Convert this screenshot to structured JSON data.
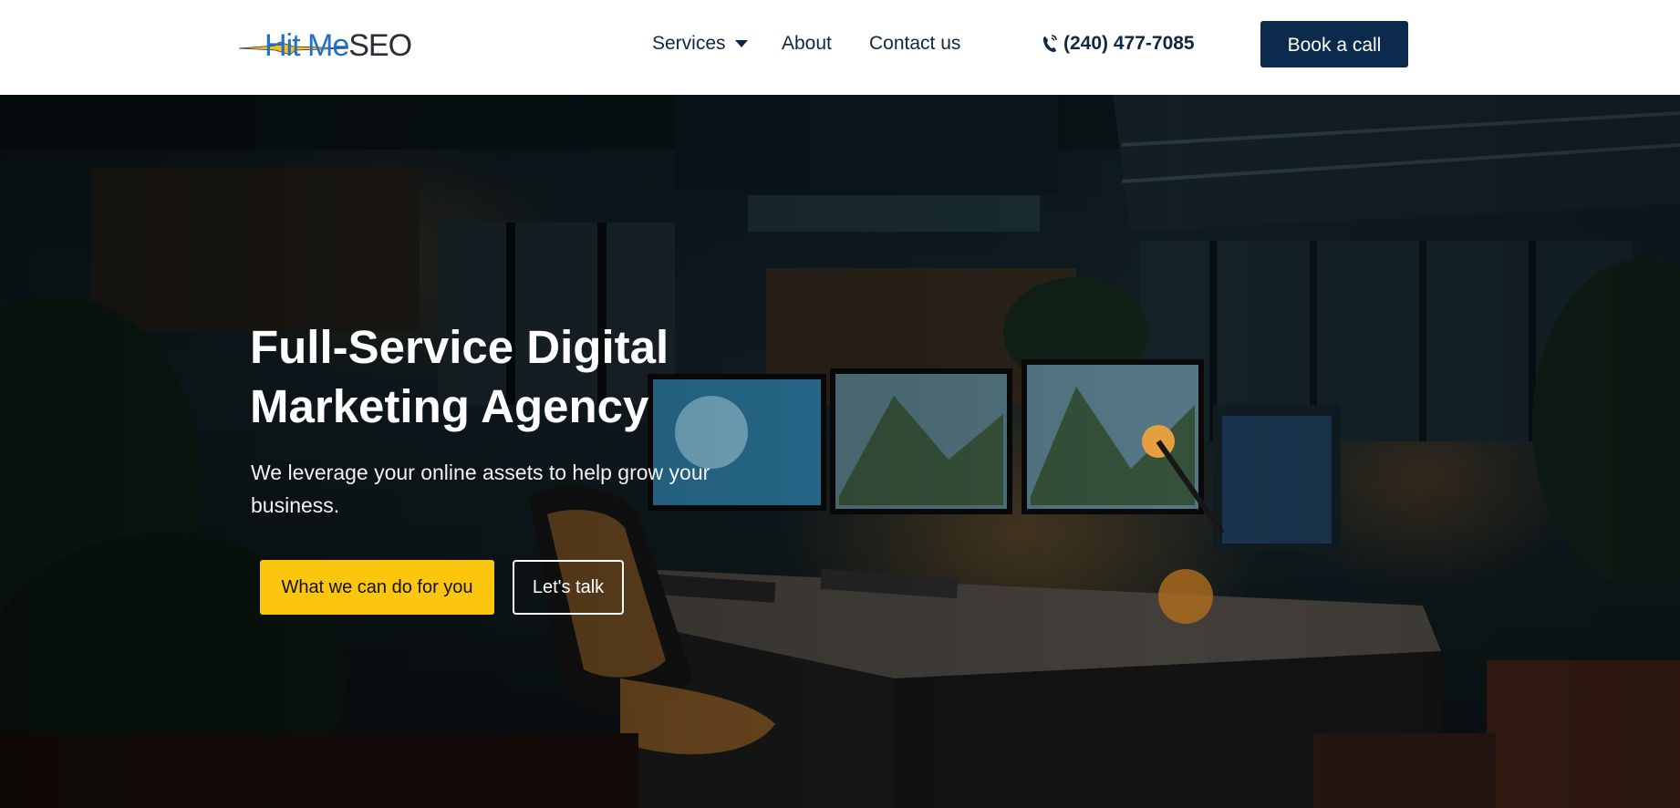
{
  "brand": {
    "logo_hit": "Hit Me",
    "logo_seo": "SEO",
    "colors": {
      "hit": "#1f6fd0",
      "seo": "#2a2f36",
      "bolt": "#f2c21a"
    }
  },
  "nav": {
    "items": [
      {
        "label": "Services",
        "icon": "caret-down-icon"
      },
      {
        "label": "About"
      },
      {
        "label": "Contact us"
      }
    ]
  },
  "header": {
    "phone": "(240) 477-7085",
    "phone_icon": "phone-icon",
    "cta_label": "Book a call"
  },
  "hero": {
    "title_line1": "Full-Service Digital",
    "title_line2": "Marketing Agency",
    "subtitle": "We leverage your online assets to help grow your business.",
    "primary_cta": "What we can do for you",
    "secondary_cta": "Let's talk"
  },
  "colors": {
    "navy": "#0b2a4d",
    "nav_text": "#0f2742",
    "accent_yellow": "#fcc50e"
  }
}
